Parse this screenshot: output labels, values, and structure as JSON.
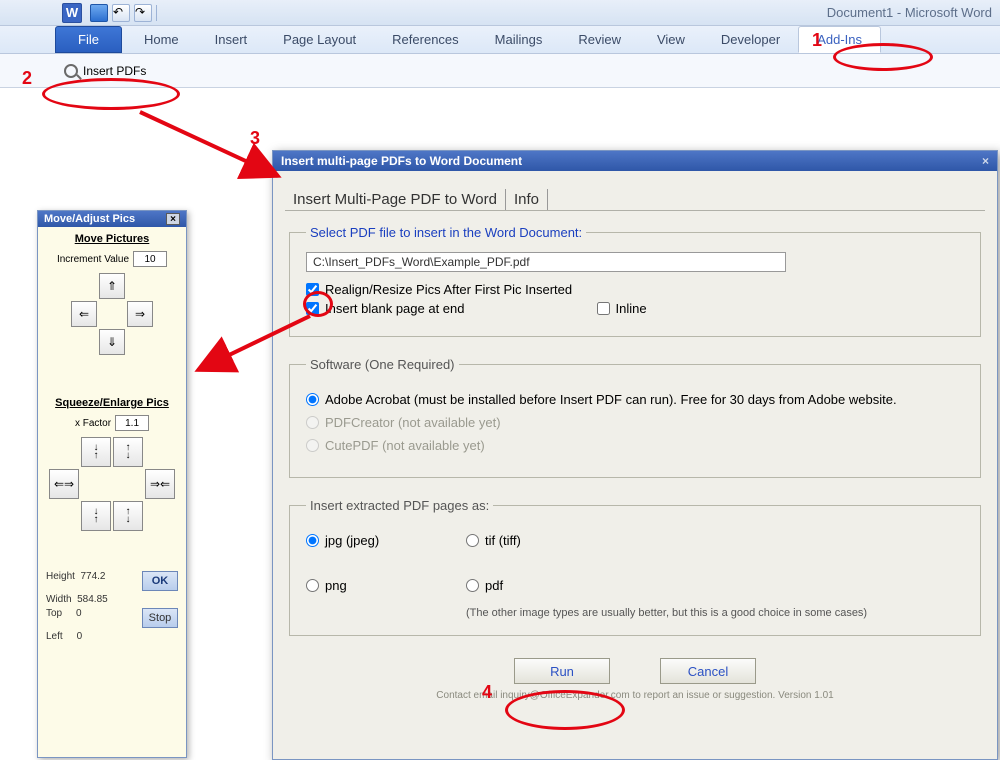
{
  "window": {
    "doc_title": "Document1 - Microsoft Word"
  },
  "ribbon": {
    "file_label": "File",
    "tabs": [
      "Home",
      "Insert",
      "Page Layout",
      "References",
      "Mailings",
      "Review",
      "View",
      "Developer",
      "Add-Ins"
    ]
  },
  "ribbon_body": {
    "insert_pdfs_label": "Insert PDFs"
  },
  "move_panel": {
    "title": "Move/Adjust Pics",
    "move_head": "Move Pictures",
    "increment_label": "Increment Value",
    "increment_value": "10",
    "squeeze_head": "Squeeze/Enlarge Pics",
    "xfactor_label": "x Factor",
    "xfactor_value": "1.1",
    "stats": {
      "height_label": "Height",
      "height_val": "774.2",
      "width_label": "Width",
      "width_val": "584.85",
      "top_label": "Top",
      "top_val": "0",
      "left_label": "Left",
      "left_val": "0"
    },
    "ok_label": "OK",
    "stop_label": "Stop"
  },
  "dialog": {
    "title": "Insert multi-page PDFs to Word Document",
    "tab1": "Insert Multi-Page PDF to Word",
    "tab2": "Info",
    "select_legend": "Select PDF file to insert in the Word Document:",
    "path_value": "C:\\Insert_PDFs_Word\\Example_PDF.pdf",
    "realign_label": "Realign/Resize Pics After First Pic Inserted",
    "blank_label": "Insert blank page at end",
    "inline_label": "Inline",
    "software_legend": "Software (One Required)",
    "soft_adobe": "Adobe Acrobat (must be installed before Insert PDF can run).  Free for 30 days from Adobe website.",
    "soft_pdfcreator": "PDFCreator (not available yet)",
    "soft_cutepdf": "CutePDF (not available yet)",
    "fmt_legend": "Insert extracted PDF pages as:",
    "fmt_jpg": "jpg (jpeg)",
    "fmt_tif": "tif (tiff)",
    "fmt_png": "png",
    "fmt_pdf": "pdf",
    "fmt_hint": "(The other image types are usually better, but this is a good choice in some cases)",
    "run_label": "Run",
    "cancel_label": "Cancel",
    "footer": "Contact email inquiry@OfficeExpander.com to report an issue or suggestion.   Version 1.01"
  },
  "annotations": {
    "n1": "1",
    "n2": "2",
    "n3": "3",
    "n4": "4"
  }
}
